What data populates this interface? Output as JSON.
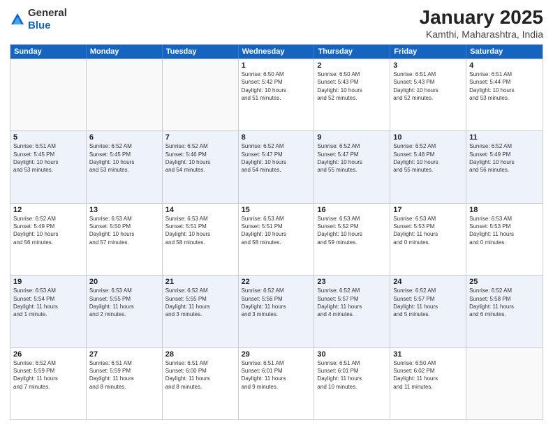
{
  "logo": {
    "general": "General",
    "blue": "Blue"
  },
  "title": "January 2025",
  "location": "Kamthi, Maharashtra, India",
  "weekdays": [
    "Sunday",
    "Monday",
    "Tuesday",
    "Wednesday",
    "Thursday",
    "Friday",
    "Saturday"
  ],
  "rows": [
    [
      {
        "day": "",
        "text": ""
      },
      {
        "day": "",
        "text": ""
      },
      {
        "day": "",
        "text": ""
      },
      {
        "day": "1",
        "text": "Sunrise: 6:50 AM\nSunset: 5:42 PM\nDaylight: 10 hours\nand 51 minutes."
      },
      {
        "day": "2",
        "text": "Sunrise: 6:50 AM\nSunset: 5:43 PM\nDaylight: 10 hours\nand 52 minutes."
      },
      {
        "day": "3",
        "text": "Sunrise: 6:51 AM\nSunset: 5:43 PM\nDaylight: 10 hours\nand 52 minutes."
      },
      {
        "day": "4",
        "text": "Sunrise: 6:51 AM\nSunset: 5:44 PM\nDaylight: 10 hours\nand 53 minutes."
      }
    ],
    [
      {
        "day": "5",
        "text": "Sunrise: 6:51 AM\nSunset: 5:45 PM\nDaylight: 10 hours\nand 53 minutes."
      },
      {
        "day": "6",
        "text": "Sunrise: 6:52 AM\nSunset: 5:45 PM\nDaylight: 10 hours\nand 53 minutes."
      },
      {
        "day": "7",
        "text": "Sunrise: 6:52 AM\nSunset: 5:46 PM\nDaylight: 10 hours\nand 54 minutes."
      },
      {
        "day": "8",
        "text": "Sunrise: 6:52 AM\nSunset: 5:47 PM\nDaylight: 10 hours\nand 54 minutes."
      },
      {
        "day": "9",
        "text": "Sunrise: 6:52 AM\nSunset: 5:47 PM\nDaylight: 10 hours\nand 55 minutes."
      },
      {
        "day": "10",
        "text": "Sunrise: 6:52 AM\nSunset: 5:48 PM\nDaylight: 10 hours\nand 55 minutes."
      },
      {
        "day": "11",
        "text": "Sunrise: 6:52 AM\nSunset: 5:49 PM\nDaylight: 10 hours\nand 56 minutes."
      }
    ],
    [
      {
        "day": "12",
        "text": "Sunrise: 6:52 AM\nSunset: 5:49 PM\nDaylight: 10 hours\nand 56 minutes."
      },
      {
        "day": "13",
        "text": "Sunrise: 6:53 AM\nSunset: 5:50 PM\nDaylight: 10 hours\nand 57 minutes."
      },
      {
        "day": "14",
        "text": "Sunrise: 6:53 AM\nSunset: 5:51 PM\nDaylight: 10 hours\nand 58 minutes."
      },
      {
        "day": "15",
        "text": "Sunrise: 6:53 AM\nSunset: 5:51 PM\nDaylight: 10 hours\nand 58 minutes."
      },
      {
        "day": "16",
        "text": "Sunrise: 6:53 AM\nSunset: 5:52 PM\nDaylight: 10 hours\nand 59 minutes."
      },
      {
        "day": "17",
        "text": "Sunrise: 6:53 AM\nSunset: 5:53 PM\nDaylight: 11 hours\nand 0 minutes."
      },
      {
        "day": "18",
        "text": "Sunrise: 6:53 AM\nSunset: 5:53 PM\nDaylight: 11 hours\nand 0 minutes."
      }
    ],
    [
      {
        "day": "19",
        "text": "Sunrise: 6:53 AM\nSunset: 5:54 PM\nDaylight: 11 hours\nand 1 minute."
      },
      {
        "day": "20",
        "text": "Sunrise: 6:53 AM\nSunset: 5:55 PM\nDaylight: 11 hours\nand 2 minutes."
      },
      {
        "day": "21",
        "text": "Sunrise: 6:52 AM\nSunset: 5:55 PM\nDaylight: 11 hours\nand 3 minutes."
      },
      {
        "day": "22",
        "text": "Sunrise: 6:52 AM\nSunset: 5:56 PM\nDaylight: 11 hours\nand 3 minutes."
      },
      {
        "day": "23",
        "text": "Sunrise: 6:52 AM\nSunset: 5:57 PM\nDaylight: 11 hours\nand 4 minutes."
      },
      {
        "day": "24",
        "text": "Sunrise: 6:52 AM\nSunset: 5:57 PM\nDaylight: 11 hours\nand 5 minutes."
      },
      {
        "day": "25",
        "text": "Sunrise: 6:52 AM\nSunset: 5:58 PM\nDaylight: 11 hours\nand 6 minutes."
      }
    ],
    [
      {
        "day": "26",
        "text": "Sunrise: 6:52 AM\nSunset: 5:59 PM\nDaylight: 11 hours\nand 7 minutes."
      },
      {
        "day": "27",
        "text": "Sunrise: 6:51 AM\nSunset: 5:59 PM\nDaylight: 11 hours\nand 8 minutes."
      },
      {
        "day": "28",
        "text": "Sunrise: 6:51 AM\nSunset: 6:00 PM\nDaylight: 11 hours\nand 8 minutes."
      },
      {
        "day": "29",
        "text": "Sunrise: 6:51 AM\nSunset: 6:01 PM\nDaylight: 11 hours\nand 9 minutes."
      },
      {
        "day": "30",
        "text": "Sunrise: 6:51 AM\nSunset: 6:01 PM\nDaylight: 11 hours\nand 10 minutes."
      },
      {
        "day": "31",
        "text": "Sunrise: 6:50 AM\nSunset: 6:02 PM\nDaylight: 11 hours\nand 11 minutes."
      },
      {
        "day": "",
        "text": ""
      }
    ]
  ]
}
